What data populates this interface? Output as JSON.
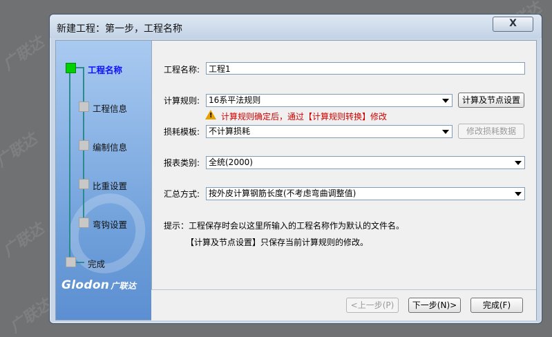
{
  "watermark": "广联达",
  "window": {
    "title": "新建工程：第一步，工程名称",
    "close_label": "X"
  },
  "sidebar": {
    "steps": [
      {
        "label": "工程名称",
        "active": true
      },
      {
        "label": "工程信息",
        "active": false
      },
      {
        "label": "编制信息",
        "active": false
      },
      {
        "label": "比重设置",
        "active": false
      },
      {
        "label": "弯钩设置",
        "active": false
      },
      {
        "label": "完成",
        "active": false
      }
    ],
    "logo_text": "Glodon",
    "logo_cn": "广联达"
  },
  "form": {
    "project_name_label": "工程名称:",
    "project_name_value": "工程1",
    "calc_rule_label": "计算规则:",
    "calc_rule_value": "16系平法规则",
    "calc_settings_button": "计算及节点设置",
    "warning_text": "计算规则确定后，通过【计算规则转换】修改",
    "loss_template_label": "损耗模板:",
    "loss_template_value": "不计算损耗",
    "modify_loss_button": "修改损耗数据",
    "report_type_label": "报表类别:",
    "report_type_value": "全统(2000)",
    "summary_method_label": "汇总方式:",
    "summary_method_value": "按外皮计算钢筋长度(不考虑弯曲调整值)",
    "tip_line1": "提示：工程保存时会以这里所输入的工程名称作为默认的文件名。",
    "tip_line2": "【计算及节点设置】只保存当前计算规则的修改。"
  },
  "footer": {
    "prev_button": "<上一步(P)",
    "next_button": "下一步(N)>",
    "finish_button": "完成(F)"
  }
}
